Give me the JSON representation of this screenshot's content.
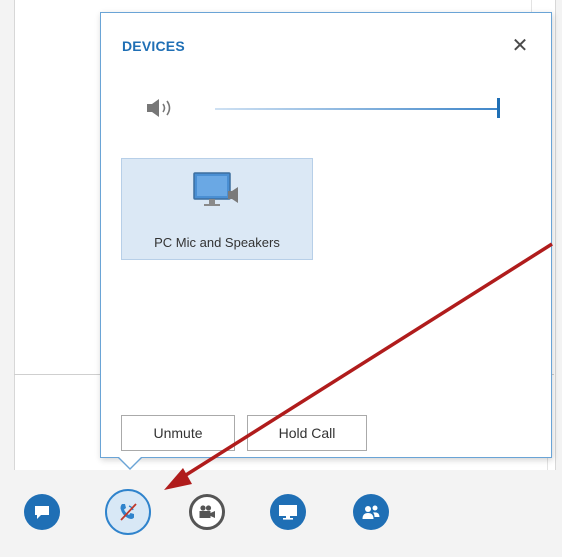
{
  "flyout": {
    "title": "DEVICES",
    "close_icon": "close-icon",
    "speaker_icon": "speaker-volume-icon",
    "volume_level": 1.0,
    "device": {
      "label": "PC Mic and Speakers",
      "icon": "monitor-speaker-icon"
    },
    "buttons": {
      "unmute": "Unmute",
      "hold": "Hold Call"
    }
  },
  "toolbar": {
    "items": [
      {
        "name": "im",
        "icon": "chat-bubble-icon"
      },
      {
        "name": "audio",
        "icon": "muted-phone-icon",
        "active": true
      },
      {
        "name": "video",
        "icon": "video-camera-icon"
      },
      {
        "name": "present",
        "icon": "monitor-icon"
      },
      {
        "name": "participants",
        "icon": "people-icon"
      }
    ]
  },
  "colors": {
    "accent": "#1f6fb5",
    "flyout_border": "#6aa4d6",
    "tile_bg": "#dbe8f5",
    "annotation_arrow": "#b01c1c"
  }
}
